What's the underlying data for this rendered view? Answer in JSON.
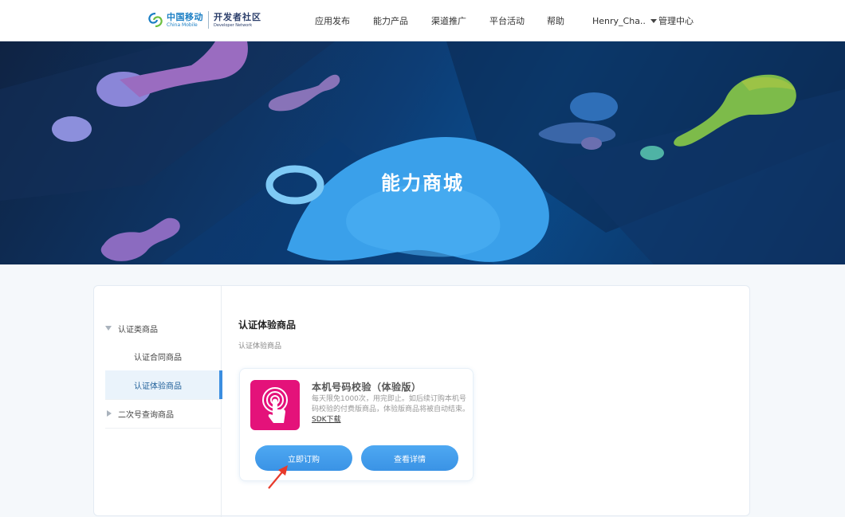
{
  "header": {
    "logo": {
      "brand_cn": "中国移动",
      "brand_en": "China Mobile",
      "community_cn": "开发者社区",
      "community_en": "Developer Network"
    },
    "nav": [
      "应用发布",
      "能力产品",
      "渠道推广",
      "平台活动",
      "帮助"
    ],
    "user_name": "Henry_Cha..",
    "manage_label": "管理中心"
  },
  "banner": {
    "title": "能力商城"
  },
  "sidebar": {
    "groups": [
      {
        "label": "认证类商品",
        "expanded": true,
        "items": [
          "认证合同商品",
          "认证体验商品"
        ]
      },
      {
        "label": "二次号查询商品",
        "expanded": false,
        "items": []
      }
    ],
    "active_item": "认证体验商品"
  },
  "content": {
    "title": "认证体验商品",
    "breadcrumb": "认证体验商品",
    "product": {
      "name": "本机号码校验（体验版）",
      "description": "每天限免1000次，用完即止。如后续订购本机号码校验的付费版商品，体验版商品将被自动结束。",
      "sdk_link": "SDK下载",
      "subscribe_label": "立即订购",
      "details_label": "查看详情",
      "icon": "touch-fingerprint-icon"
    }
  },
  "colors": {
    "accent": "#3b8ee0",
    "product_icon_bg": "#e4127a",
    "banner_dark": "#0f2343"
  }
}
